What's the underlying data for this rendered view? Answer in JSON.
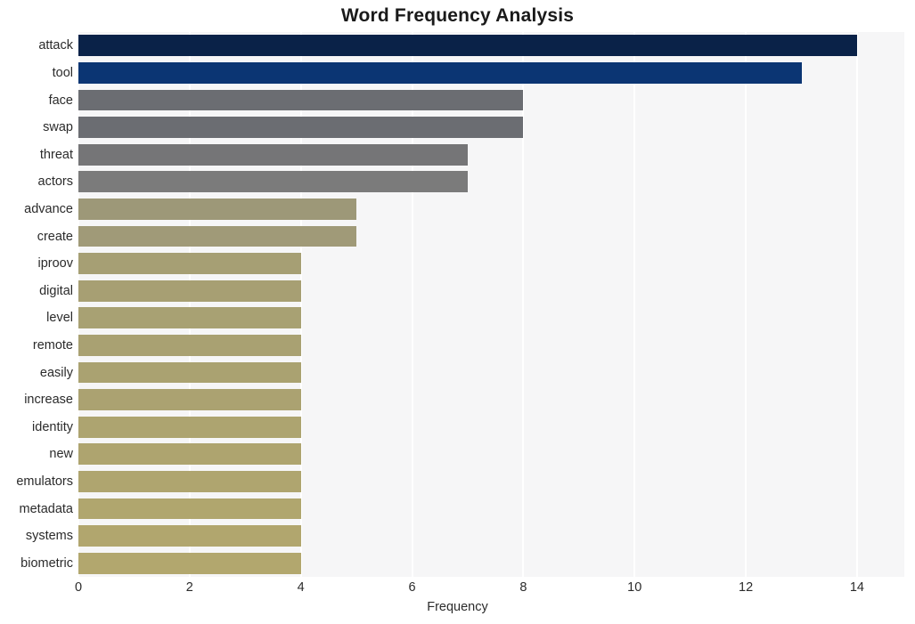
{
  "chart_data": {
    "type": "bar",
    "orientation": "horizontal",
    "title": "Word Frequency Analysis",
    "xlabel": "Frequency",
    "ylabel": "",
    "xlim": [
      0,
      14.85
    ],
    "xticks": [
      0,
      2,
      4,
      6,
      8,
      10,
      12,
      14
    ],
    "xtick_labels": [
      "0",
      "2",
      "4",
      "6",
      "8",
      "10",
      "12",
      "14"
    ],
    "grid": "vertical-only",
    "legend": "none",
    "categories": [
      "attack",
      "tool",
      "face",
      "swap",
      "threat",
      "actors",
      "advance",
      "create",
      "iproov",
      "digital",
      "level",
      "remote",
      "easily",
      "increase",
      "identity",
      "new",
      "emulators",
      "metadata",
      "systems",
      "biometric"
    ],
    "values": [
      14,
      13,
      8,
      8,
      7,
      7,
      5,
      5,
      4,
      4,
      4,
      4,
      4,
      4,
      4,
      4,
      4,
      4,
      4,
      4
    ],
    "bar_colors": [
      "#0a2248",
      "#0b3573",
      "#6b6d72",
      "#6b6d72",
      "#757577",
      "#7b7b7b",
      "#9d9878",
      "#a09a78",
      "#a69f74",
      "#a79f73",
      "#a8a173",
      "#a9a172",
      "#aaa271",
      "#aba271",
      "#ada470",
      "#aea46f",
      "#afa56f",
      "#b0a66e",
      "#b1a66e",
      "#b2a76e"
    ],
    "plot_background": "#f6f6f7",
    "gridline_color": "#ffffff",
    "figure_background": "#ffffff"
  }
}
